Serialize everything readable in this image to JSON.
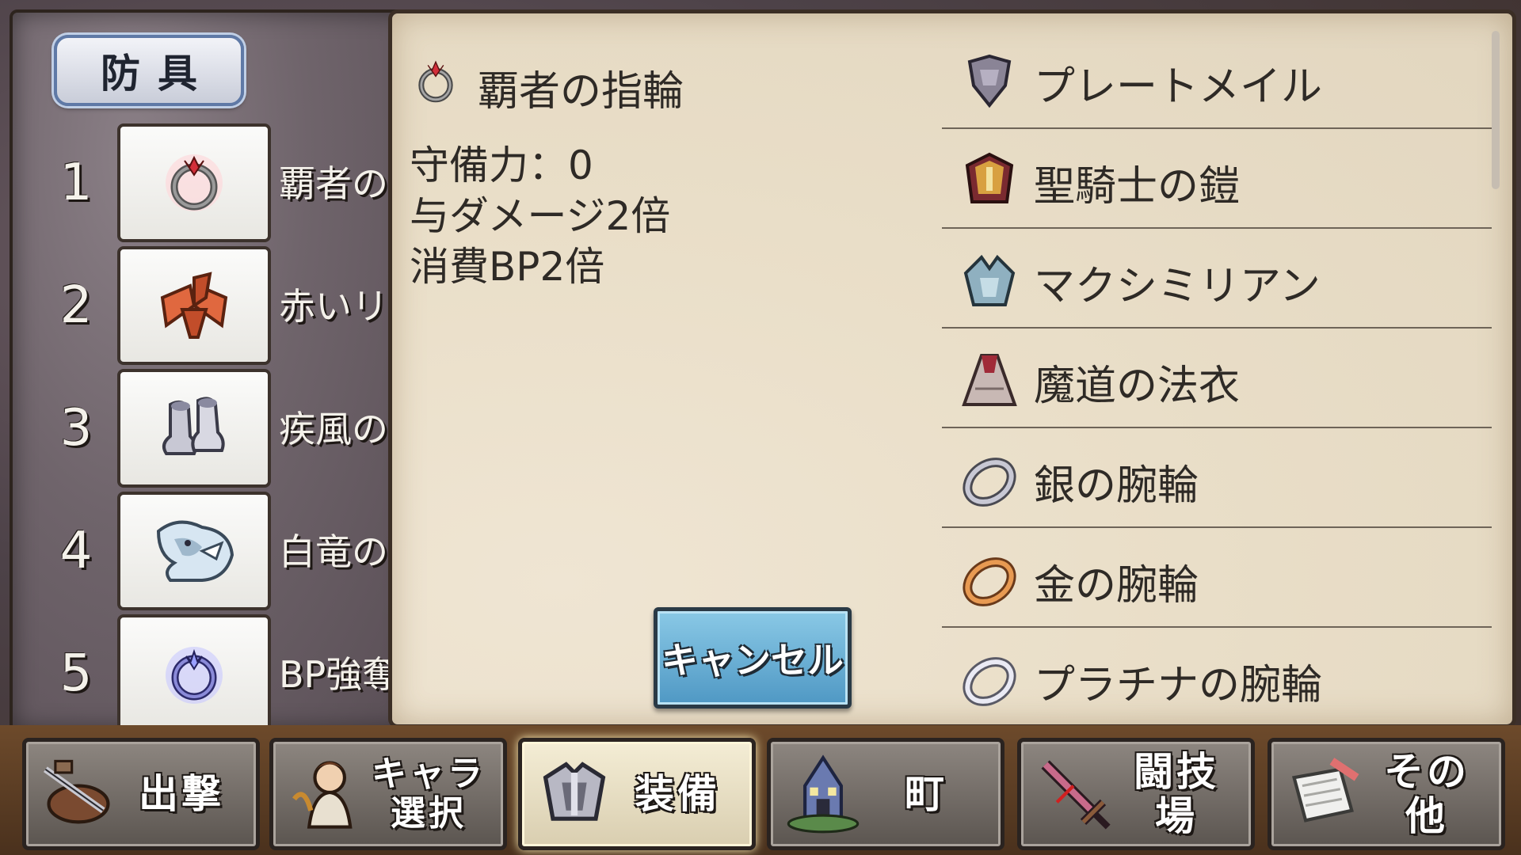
{
  "category": {
    "label": "防具"
  },
  "slots": [
    {
      "num": "1",
      "label": "覇者の",
      "icon": "ring-icon"
    },
    {
      "num": "2",
      "label": "赤いリ",
      "icon": "red-ribbon-icon"
    },
    {
      "num": "3",
      "label": "疾風の",
      "icon": "boots-icon"
    },
    {
      "num": "4",
      "label": "白竜の",
      "icon": "white-dragon-icon"
    },
    {
      "num": "5",
      "label": "BP強奪",
      "icon": "blue-ring-icon"
    }
  ],
  "selected": {
    "name": "覇者の指輪",
    "icon": "ring-icon",
    "lines": [
      "守備力：0",
      "与ダメージ2倍",
      "消費BP2倍"
    ]
  },
  "cancel": {
    "label": "キャンセル"
  },
  "armor_list": [
    {
      "label": "プレートメイル",
      "icon": "plate-armor-icon"
    },
    {
      "label": "聖騎士の鎧",
      "icon": "holy-armor-icon"
    },
    {
      "label": "マクシミリアン",
      "icon": "maximilian-armor-icon"
    },
    {
      "label": "魔道の法衣",
      "icon": "robe-icon"
    },
    {
      "label": "銀の腕輪",
      "icon": "silver-bracelet-icon"
    },
    {
      "label": "金の腕輪",
      "icon": "gold-bracelet-icon"
    },
    {
      "label": "プラチナの腕輪",
      "icon": "platinum-bracelet-icon"
    }
  ],
  "nav": [
    {
      "label": "出撃",
      "icon": "sortie-icon"
    },
    {
      "label_line1": "キャラ",
      "label_line2": "選択",
      "icon": "character-icon"
    },
    {
      "label": "装備",
      "icon": "armor-icon",
      "active": true
    },
    {
      "label": "町",
      "icon": "town-icon"
    },
    {
      "label": "闘技場",
      "icon": "sword-icon"
    },
    {
      "label": "その他",
      "icon": "scroll-icon"
    }
  ]
}
